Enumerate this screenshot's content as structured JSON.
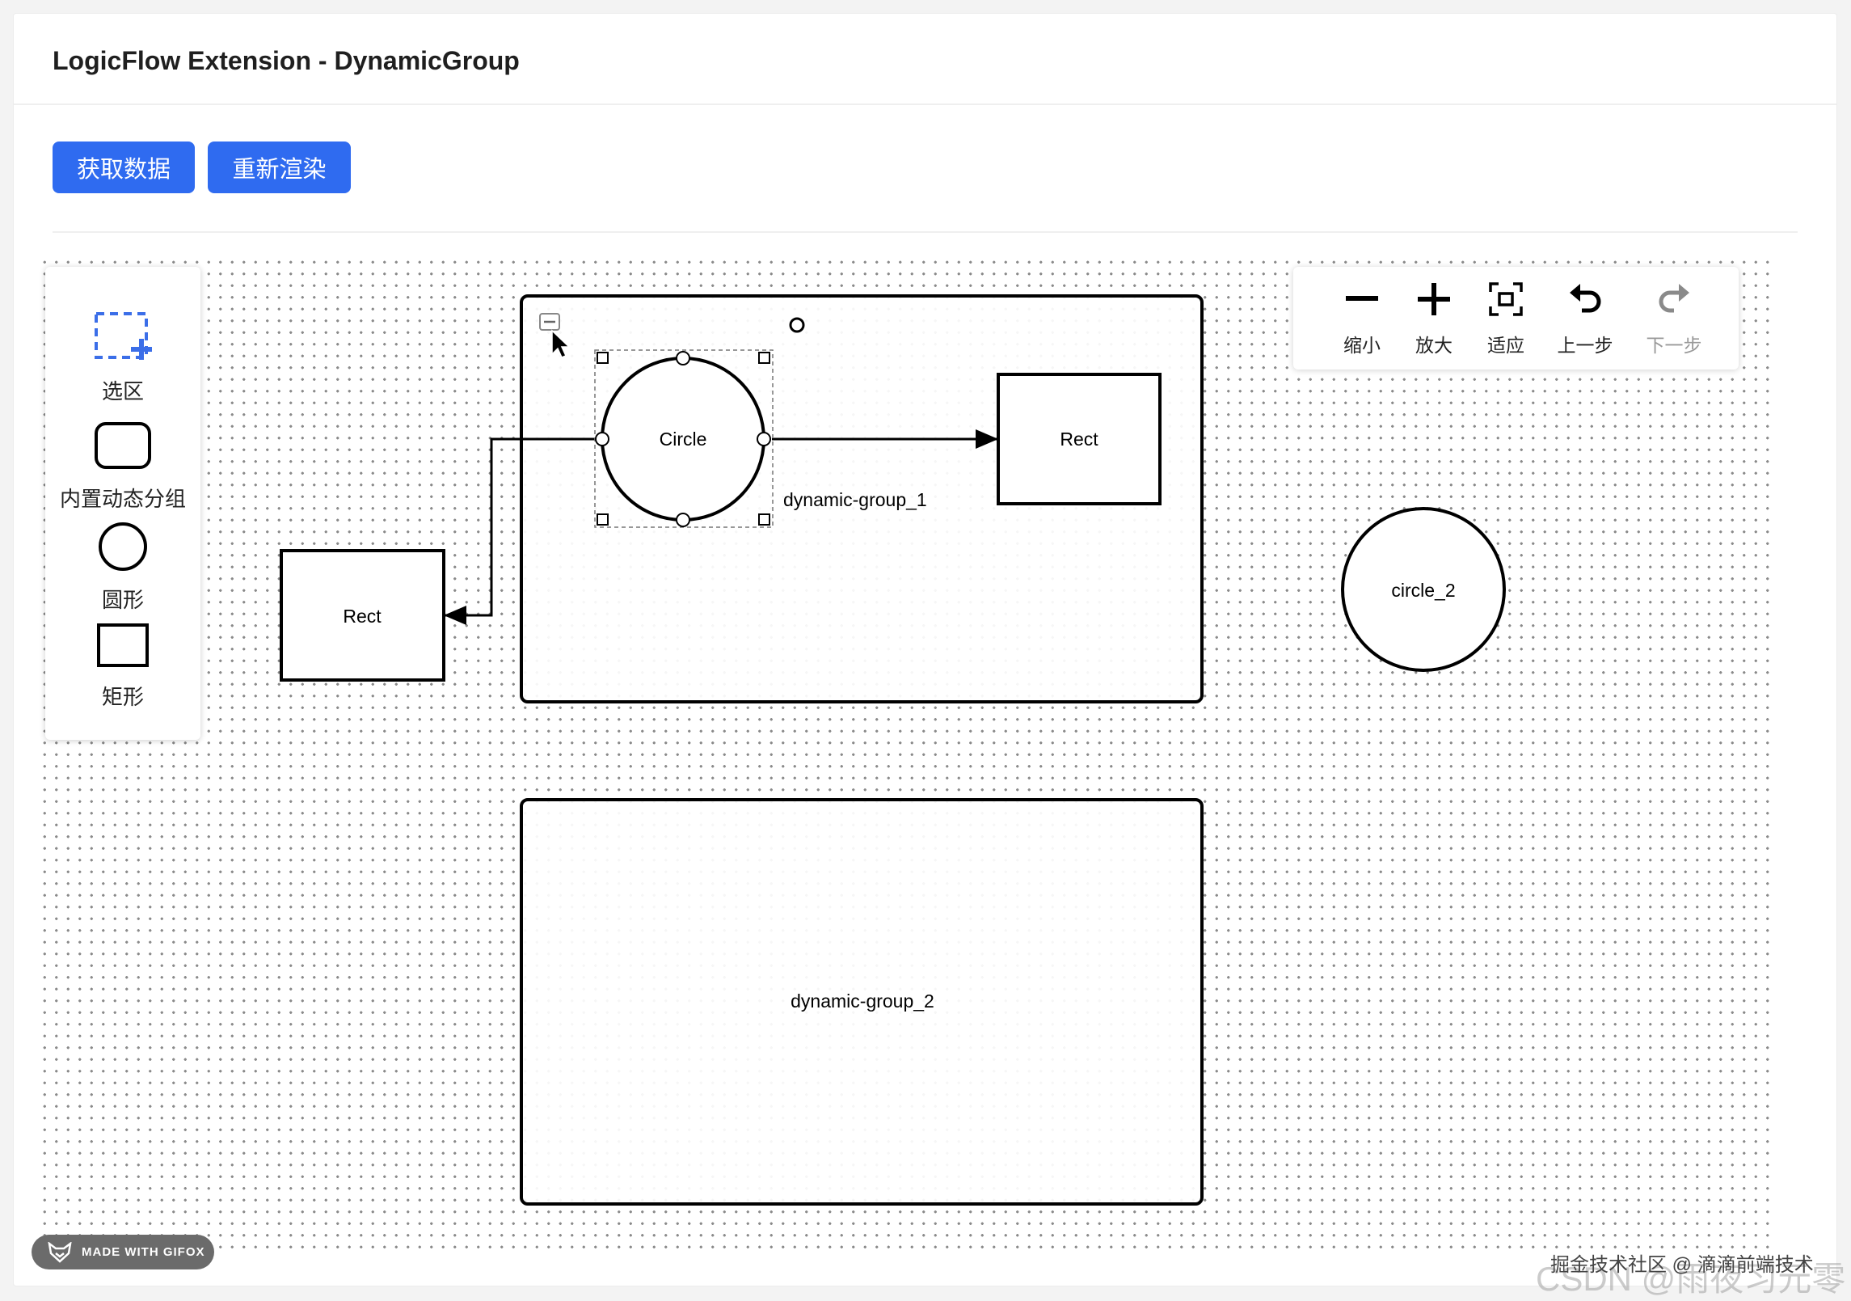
{
  "header": {
    "title": "LogicFlow Extension - DynamicGroup"
  },
  "actions": {
    "get_data_label": "获取数据",
    "rerender_label": "重新渲染"
  },
  "dnd_panel": {
    "items": [
      {
        "label": "选区",
        "icon": "selection-add-icon"
      },
      {
        "label": "内置动态分组",
        "icon": "rounded-rect-icon"
      },
      {
        "label": "圆形",
        "icon": "circle-icon"
      },
      {
        "label": "矩形",
        "icon": "rect-icon"
      }
    ]
  },
  "control": {
    "items": [
      {
        "label": "缩小",
        "icon": "minus-icon",
        "disabled": false
      },
      {
        "label": "放大",
        "icon": "plus-icon",
        "disabled": false
      },
      {
        "label": "适应",
        "icon": "fit-icon",
        "disabled": false
      },
      {
        "label": "上一步",
        "icon": "undo-icon",
        "disabled": false
      },
      {
        "label": "下一步",
        "icon": "redo-icon",
        "disabled": true
      }
    ]
  },
  "graph": {
    "groups": [
      {
        "id": "dynamic-group_1",
        "label": "dynamic-group_1",
        "collapse_icon": "collapse-minus-icon"
      },
      {
        "id": "dynamic-group_2",
        "label": "dynamic-group_2"
      }
    ],
    "nodes": [
      {
        "id": "circle-1",
        "type": "circle",
        "label": "Circle",
        "selected": true
      },
      {
        "id": "rect-in-group",
        "type": "rect",
        "label": "Rect"
      },
      {
        "id": "rect-outside",
        "type": "rect",
        "label": "Rect"
      },
      {
        "id": "circle_2",
        "type": "circle",
        "label": "circle_2"
      }
    ]
  },
  "badge": {
    "label": "MADE WITH GIFOX",
    "icon": "fox-icon"
  },
  "watermark": {
    "line1": "掘金技术社区 @ 滴滴前端技术",
    "line2": "CSDN @雨夜习元零"
  },
  "colors": {
    "primary": "#2f6bf0",
    "selection_blue": "#3b6ee8"
  }
}
